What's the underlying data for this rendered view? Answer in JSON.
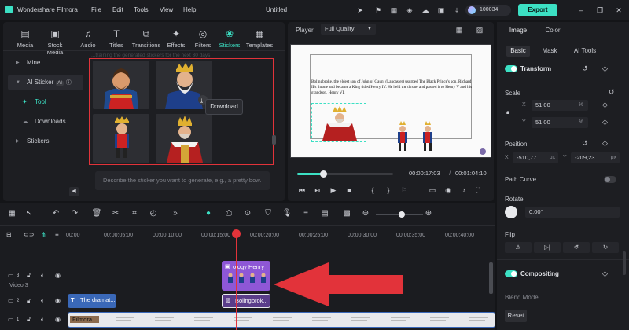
{
  "titlebar": {
    "app_name": "Wondershare Filmora",
    "menus": [
      "File",
      "Edit",
      "Tools",
      "View",
      "Help"
    ],
    "doc_title": "Untitled",
    "credits": "100034",
    "export_label": "Export"
  },
  "media_tabs": [
    {
      "label": "Media",
      "icon": "media-icon"
    },
    {
      "label": "Stock Media",
      "icon": "stock-media-icon"
    },
    {
      "label": "Audio",
      "icon": "music-note-icon"
    },
    {
      "label": "Titles",
      "icon": "text-t-icon"
    },
    {
      "label": "Transitions",
      "icon": "transitions-icon"
    },
    {
      "label": "Effects",
      "icon": "effects-icon"
    },
    {
      "label": "Filters",
      "icon": "filters-icon"
    },
    {
      "label": "Stickers",
      "icon": "stickers-icon",
      "active": true
    },
    {
      "label": "Templates",
      "icon": "templates-icon"
    }
  ],
  "sidebar": {
    "items": [
      {
        "label": "Mine"
      },
      {
        "label": "AI Sticker",
        "badge": "AI"
      },
      {
        "label": "Tool"
      },
      {
        "label": "Downloads"
      },
      {
        "label": "Stickers"
      }
    ]
  },
  "stickers": {
    "faded_header": "...training the generated stickers for the next 30 days",
    "tooltip": "Download",
    "prompt_placeholder": "Describe the sticker you want to generate, e.g., a pretty bow."
  },
  "player": {
    "label": "Player",
    "quality": "Full Quality",
    "doc_text": "Bolingbroke, the eldest son of John of Gaunt (Lancaster) usurped The Black Prince's son, Richard II's throne and became a King titled Henry IV. He held the throne and passed it to Henry V and his grandson, Henry VI.",
    "current_time": "00:00:17:03",
    "total_time": "00:01:04:10",
    "progress": 0.27
  },
  "properties": {
    "tabs": [
      "Image",
      "Color"
    ],
    "subtabs": [
      "Basic",
      "Mask",
      "AI Tools"
    ],
    "transform_label": "Transform",
    "scale_label": "Scale",
    "scale_x": "51,00",
    "scale_y": "51,00",
    "scale_unit": "%",
    "position_label": "Position",
    "pos_x": "-510,77",
    "pos_y": "-209,23",
    "pos_unit": "px",
    "path_curve_label": "Path Curve",
    "rotate_label": "Rotate",
    "rotate_value": "0,00°",
    "flip_label": "Flip",
    "compositing_label": "Compositing",
    "blend_mode_label": "Blend Mode",
    "reset_label": "Reset",
    "axis_x": "X",
    "axis_y": "Y"
  },
  "timeline": {
    "ticks": [
      "00:00",
      "00:00:05:00",
      "00:00:10:00",
      "00:00:15:00",
      "00:00:20:00",
      "00:00:25:00",
      "00:00:30:00",
      "00:00:35:00",
      "00:00:40:00"
    ],
    "tracks": {
      "video3_label": "Video 3",
      "track3_num": "3",
      "track2_num": "2",
      "track1_num": "1"
    },
    "clips": {
      "sticker_clip": "ology Henry",
      "image_clip": "Bolingbrok...",
      "title_clip": "The dramat...",
      "video_clip": "Filmora..."
    },
    "zoom_level": 0.55
  }
}
